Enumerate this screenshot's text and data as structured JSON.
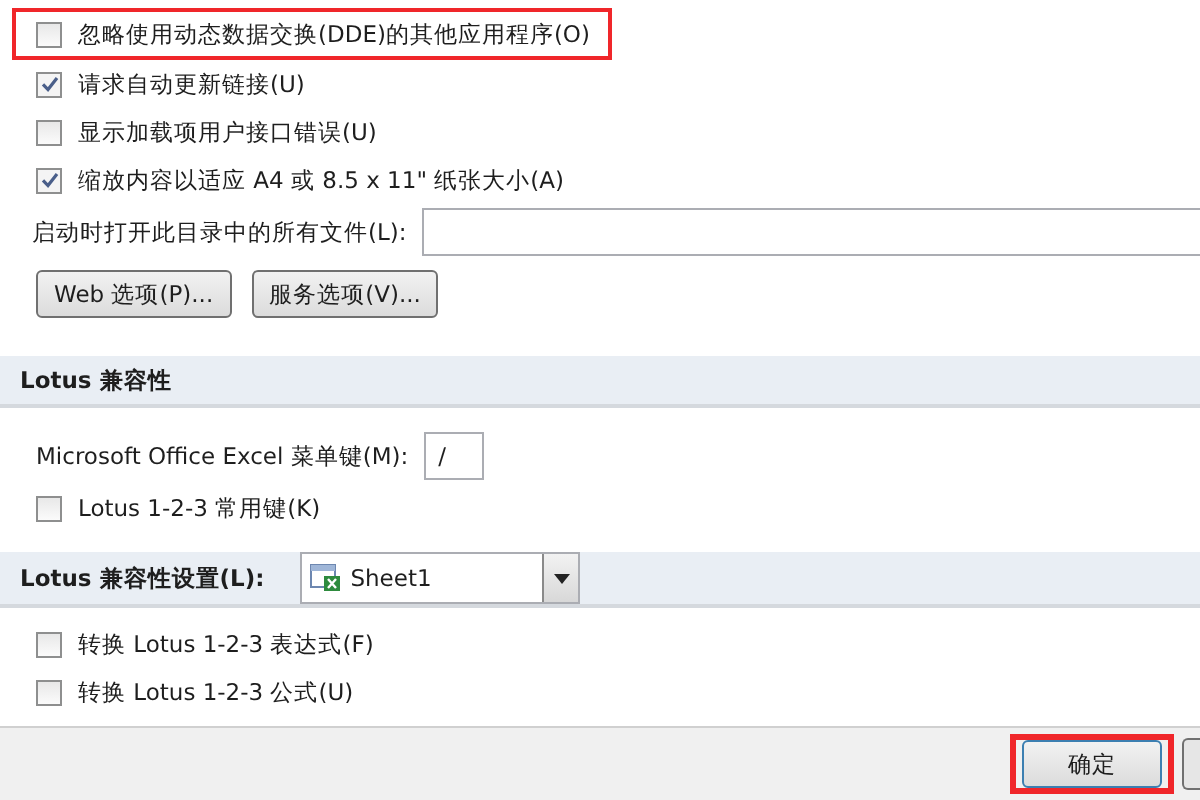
{
  "general_options": [
    {
      "label": "忽略使用动态数据交换(DDE)的其他应用程序(O)",
      "checked": false,
      "highlighted": true
    },
    {
      "label": "请求自动更新链接(U)",
      "checked": true,
      "highlighted": false
    },
    {
      "label": "显示加载项用户接口错误(U)",
      "checked": false,
      "highlighted": false
    },
    {
      "label": "缩放内容以适应 A4 或 8.5 x 11\" 纸张大小(A)",
      "checked": true,
      "highlighted": false
    }
  ],
  "startup_folder": {
    "label": "启动时打开此目录中的所有文件(L):"
  },
  "option_buttons": [
    "Web 选项(P)...",
    "服务选项(V)..."
  ],
  "lotus_section": {
    "title": "Lotus 兼容性",
    "menu_key_label": "Microsoft Office Excel 菜单键(M):",
    "menu_key_value": "/",
    "options": [
      {
        "label": "Lotus 1-2-3 常用键(K)",
        "checked": false
      }
    ]
  },
  "lotus_settings": {
    "title": "Lotus 兼容性设置(L):",
    "sheet": "Sheet1",
    "options": [
      {
        "label": "转换 Lotus 1-2-3 表达式(F)",
        "checked": false
      },
      {
        "label": "转换 Lotus 1-2-3 公式(U)",
        "checked": false
      }
    ]
  },
  "footer": {
    "ok_button": "确定",
    "ok_highlighted": true
  }
}
